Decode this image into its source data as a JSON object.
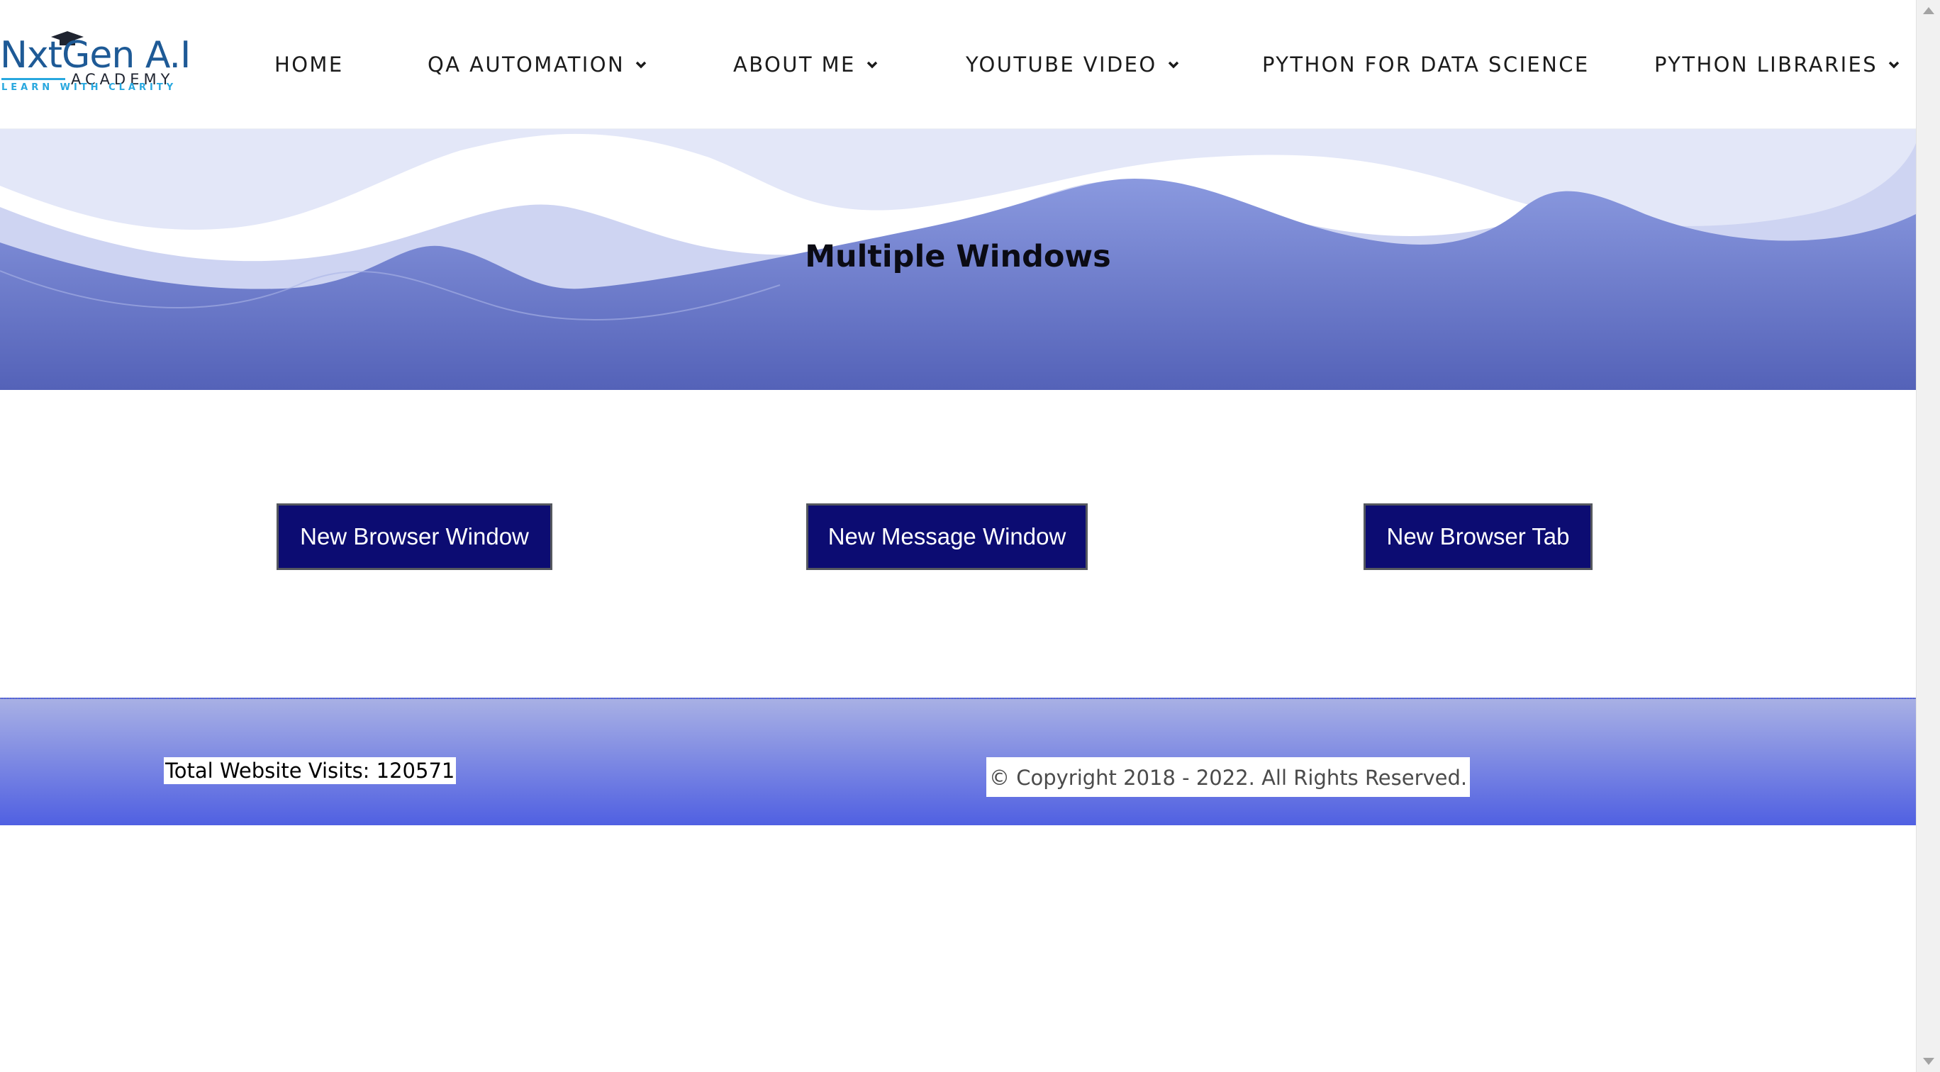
{
  "logo": {
    "main": "NxtGen A.I",
    "sub": "ACADEMY",
    "tagline": "LEARN WITH CLARITY"
  },
  "nav": {
    "items": [
      {
        "label": "HOME",
        "has_dropdown": false
      },
      {
        "label": "QA AUTOMATION",
        "has_dropdown": true
      },
      {
        "label": "ABOUT ME",
        "has_dropdown": true
      },
      {
        "label": "YOUTUBE VIDEO",
        "has_dropdown": true
      },
      {
        "label": "PYTHON FOR DATA SCIENCE",
        "has_dropdown": false
      },
      {
        "label": "PYTHON LIBRARIES",
        "has_dropdown": true
      }
    ]
  },
  "hero": {
    "title": "Multiple Windows"
  },
  "buttons": {
    "browser_window": "New Browser Window",
    "message_window": "New Message Window",
    "browser_tab": "New Browser Tab"
  },
  "footer": {
    "visits": "Total Website Visits: 120571",
    "copyright": "© Copyright 2018 - 2022. All Rights Reserved."
  },
  "colors": {
    "button_bg": "#0c0c72",
    "hero_deep": "#5462b8",
    "footer_bottom": "#5060e2"
  }
}
